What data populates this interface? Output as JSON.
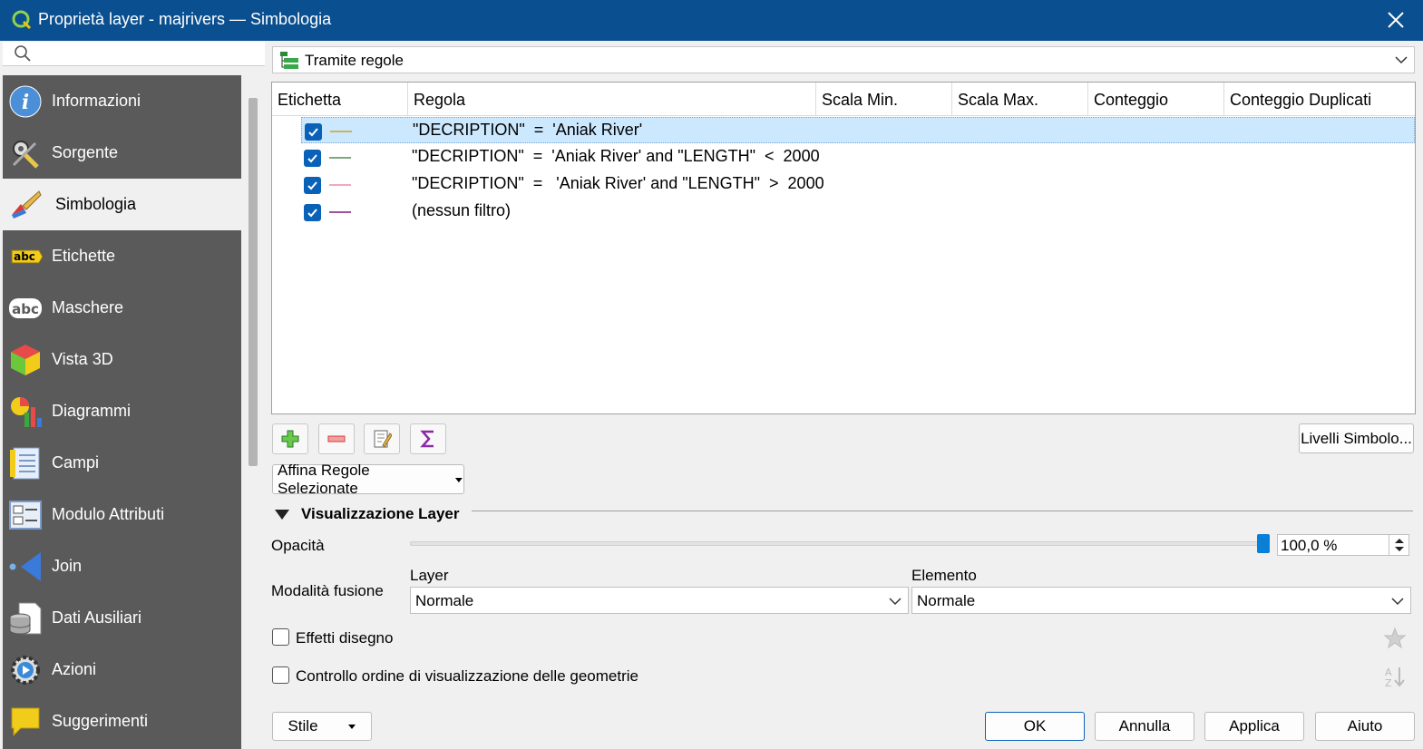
{
  "window": {
    "title": "Proprietà layer - majrivers — Simbologia"
  },
  "search": {
    "placeholder": ""
  },
  "sidebar": {
    "items": [
      {
        "label": "Informazioni",
        "icon": "info-icon"
      },
      {
        "label": "Sorgente",
        "icon": "source-tools-icon"
      },
      {
        "label": "Simbologia",
        "icon": "paintbrush-icon"
      },
      {
        "label": "Etichette",
        "icon": "abc-label-icon"
      },
      {
        "label": "Maschere",
        "icon": "abc-mask-icon"
      },
      {
        "label": "Vista 3D",
        "icon": "cube-3d-icon"
      },
      {
        "label": "Diagrammi",
        "icon": "diagram-icon"
      },
      {
        "label": "Campi",
        "icon": "fields-icon"
      },
      {
        "label": "Modulo Attributi",
        "icon": "form-icon"
      },
      {
        "label": "Join",
        "icon": "join-icon"
      },
      {
        "label": "Dati Ausiliari",
        "icon": "auxiliary-storage-icon"
      },
      {
        "label": "Azioni",
        "icon": "actions-gear-icon"
      },
      {
        "label": "Suggerimenti",
        "icon": "speech-bubble-icon"
      }
    ],
    "active": "Simbologia"
  },
  "renderer": {
    "selected": "Tramite regole"
  },
  "rules_table": {
    "columns": [
      "Etichetta",
      "Regola",
      "Scala Min.",
      "Scala Max.",
      "Conteggio",
      "Conteggio Duplicati"
    ],
    "rows": [
      {
        "checked": true,
        "color": "#c9b55a",
        "rule": "\"DECRIPTION\"  =  'Aniak River'",
        "selected": true
      },
      {
        "checked": true,
        "color": "#7fa67f",
        "rule": "\"DECRIPTION\"  =  'Aniak River' and \"LENGTH\"  <  2000",
        "selected": false
      },
      {
        "checked": true,
        "color": "#f0a8c0",
        "rule": "\"DECRIPTION\"  =   'Aniak River' and \"LENGTH\"  >  2000",
        "selected": false
      },
      {
        "checked": true,
        "color": "#a0529a",
        "rule": "(nessun filtro)",
        "selected": false
      }
    ]
  },
  "toolbar": {
    "symbol_levels": "Livelli Simbolo...",
    "refine": "Affina Regole Selezionate"
  },
  "layer_rendering": {
    "title": "Visualizzazione Layer",
    "opacity_label": "Opacità",
    "opacity_value": "100,0 %",
    "opacity_fraction": 1.0,
    "blend_label": "Modalità fusione",
    "layer_label": "Layer",
    "layer_value": "Normale",
    "feature_label": "Elemento",
    "feature_value": "Normale",
    "effects_label": "Effetti disegno",
    "order_label": "Controllo ordine di visualizzazione delle geometrie"
  },
  "footer": {
    "style": "Stile",
    "ok": "OK",
    "cancel": "Annulla",
    "apply": "Applica",
    "help": "Aiuto"
  }
}
